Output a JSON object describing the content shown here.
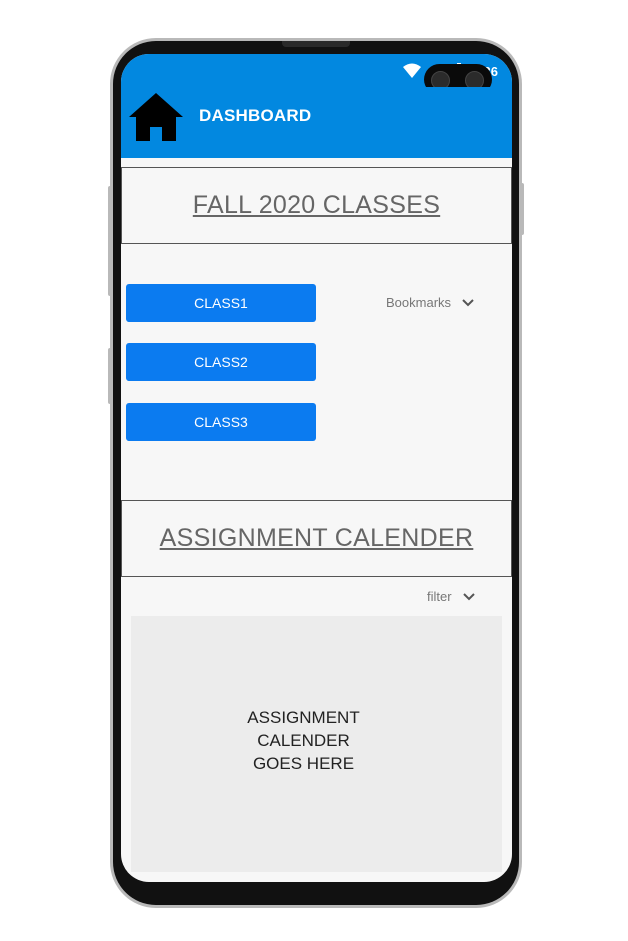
{
  "status_bar": {
    "time": "6:36"
  },
  "app_bar": {
    "title": "DASHBOARD",
    "home_icon": "home-icon"
  },
  "classes_section": {
    "title": "FALL 2020 CLASSES",
    "buttons": [
      {
        "label": "CLASS1"
      },
      {
        "label": "CLASS2"
      },
      {
        "label": "CLASS3"
      }
    ],
    "bookmarks_dropdown": {
      "label": "Bookmarks"
    }
  },
  "calendar_section": {
    "title": "ASSIGNMENT CALENDER",
    "filter_dropdown": {
      "label": "filter"
    },
    "placeholder": "ASSIGNMENT\nCALENDER\nGOES HERE"
  },
  "colors": {
    "app_bar": "#0288e0",
    "button": "#0b7bf0",
    "calendar_bg": "#ececec"
  }
}
